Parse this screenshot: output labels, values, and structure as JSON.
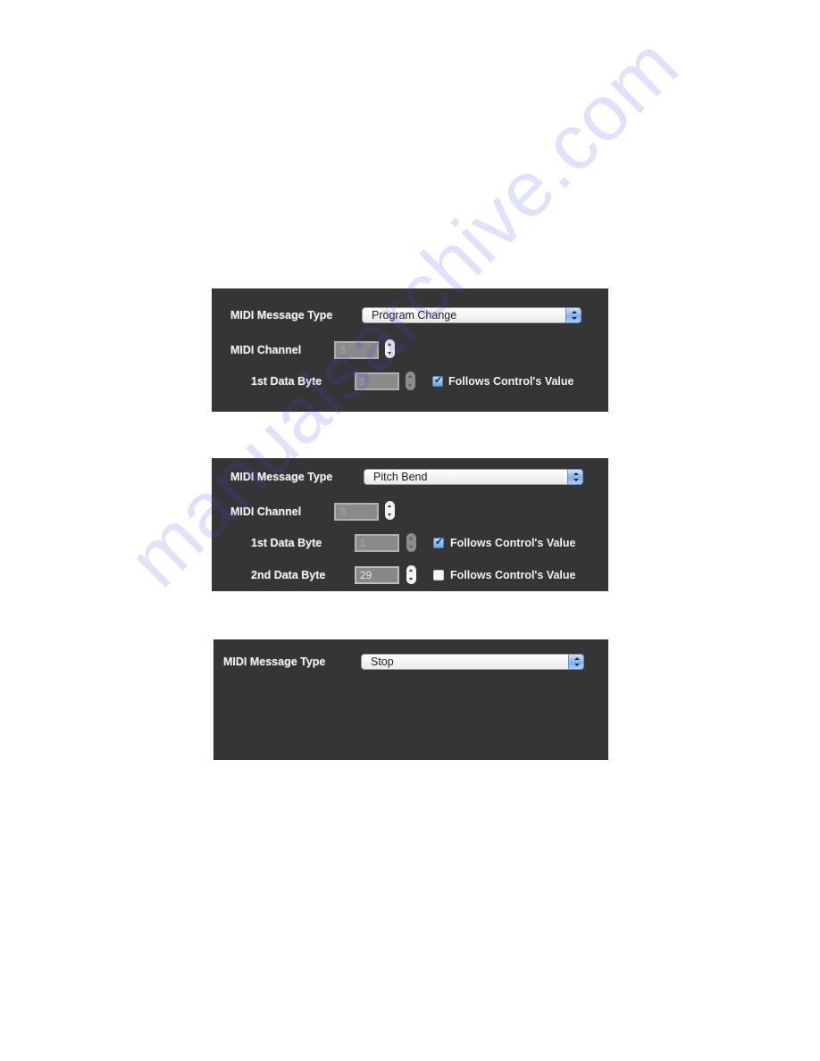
{
  "panels": [
    {
      "message_type_label": "MIDI Message Type",
      "message_type_value": "Program Change",
      "channel_label": "MIDI Channel",
      "channel_value": "3",
      "data_byte_1_label": "1st Data Byte",
      "data_byte_1_value": "1",
      "data_byte_1_follows_label": "Follows Control's Value",
      "data_byte_1_follows_checked": true
    },
    {
      "message_type_label": "MIDI Message Type",
      "message_type_value": "Pitch Bend",
      "channel_label": "MIDI Channel",
      "channel_value": "3",
      "data_byte_1_label": "1st Data Byte",
      "data_byte_1_value": "1",
      "data_byte_1_follows_label": "Follows Control's Value",
      "data_byte_1_follows_checked": true,
      "data_byte_2_label": "2nd Data Byte",
      "data_byte_2_value": "29",
      "data_byte_2_follows_label": "Follows Control's Value",
      "data_byte_2_follows_checked": false
    },
    {
      "message_type_label": "MIDI Message Type",
      "message_type_value": "Stop"
    }
  ],
  "watermark": "manualsarchive.com",
  "colors": {
    "panel_bg": "#353535",
    "accent_blue": "#7fb3ec",
    "watermark": "#4646e6"
  }
}
